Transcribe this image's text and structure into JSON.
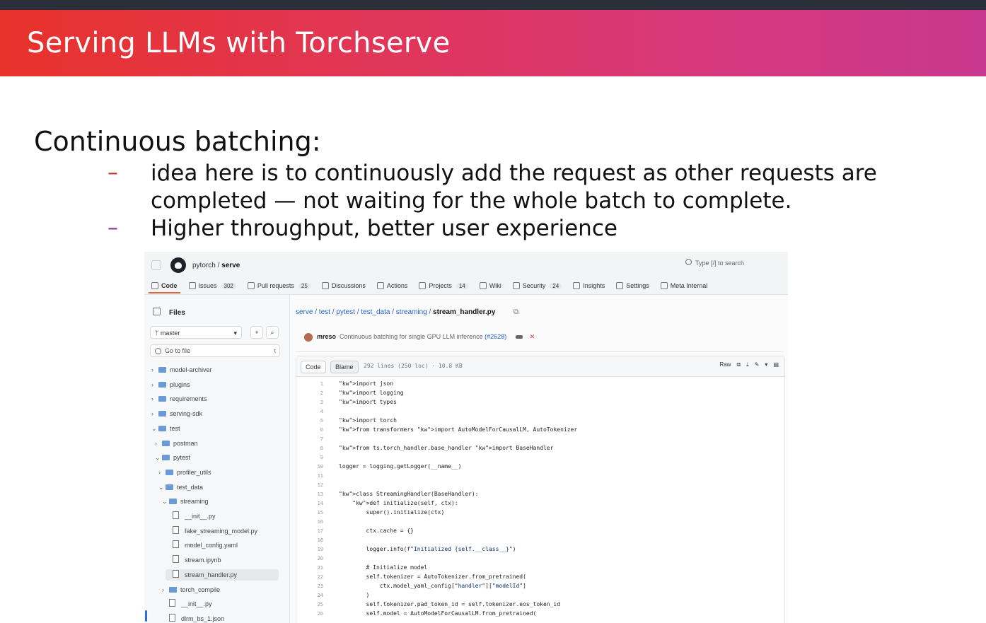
{
  "slide": {
    "title": "Serving LLMs with Torchserve",
    "heading": "Continuous batching:",
    "bullets": [
      "idea here is to continuously add the request as other requests are completed — not waiting for the whole batch to complete.",
      "Higher throughput, better user experience"
    ],
    "dash": "–"
  },
  "github": {
    "owner": "pytorch",
    "repo": "serve",
    "search_placeholder": "Type [/] to search",
    "tabs": [
      {
        "label": "Code",
        "count": ""
      },
      {
        "label": "Issues",
        "count": "302"
      },
      {
        "label": "Pull requests",
        "count": "25"
      },
      {
        "label": "Discussions",
        "count": ""
      },
      {
        "label": "Actions",
        "count": ""
      },
      {
        "label": "Projects",
        "count": "14"
      },
      {
        "label": "Wiki",
        "count": ""
      },
      {
        "label": "Security",
        "count": "24"
      },
      {
        "label": "Insights",
        "count": ""
      },
      {
        "label": "Settings",
        "count": ""
      },
      {
        "label": "Meta Internal",
        "count": ""
      }
    ],
    "sidebar": {
      "title": "Files",
      "branch": "master",
      "goto_placeholder": "Go to file",
      "goto_key": "t",
      "tree": [
        {
          "name": "model-archiver",
          "type": "folder",
          "depth": 0,
          "expanded": false
        },
        {
          "name": "plugins",
          "type": "folder",
          "depth": 0,
          "expanded": false
        },
        {
          "name": "requirements",
          "type": "folder",
          "depth": 0,
          "expanded": false
        },
        {
          "name": "serving-sdk",
          "type": "folder",
          "depth": 0,
          "expanded": false
        },
        {
          "name": "test",
          "type": "folder",
          "depth": 0,
          "expanded": true
        },
        {
          "name": "postman",
          "type": "folder",
          "depth": 1,
          "expanded": false
        },
        {
          "name": "pytest",
          "type": "folder",
          "depth": 1,
          "expanded": true
        },
        {
          "name": "profiler_utils",
          "type": "folder",
          "depth": 2,
          "expanded": false
        },
        {
          "name": "test_data",
          "type": "folder",
          "depth": 2,
          "expanded": true
        },
        {
          "name": "streaming",
          "type": "folder",
          "depth": 3,
          "expanded": true
        },
        {
          "name": "__init__.py",
          "type": "file",
          "depth": 4
        },
        {
          "name": "fake_streaming_model.py",
          "type": "file",
          "depth": 4
        },
        {
          "name": "model_config.yaml",
          "type": "file",
          "depth": 4
        },
        {
          "name": "stream.ipynb",
          "type": "file",
          "depth": 4
        },
        {
          "name": "stream_handler.py",
          "type": "file",
          "depth": 4,
          "selected": true
        },
        {
          "name": "torch_compile",
          "type": "folder",
          "depth": 3,
          "expanded": false
        },
        {
          "name": "__init__.py",
          "type": "file",
          "depth": 3
        },
        {
          "name": "dlrm_bs_1.json",
          "type": "file",
          "depth": 3
        }
      ]
    },
    "breadcrumb": [
      "serve",
      "test",
      "pytest",
      "test_data",
      "streaming"
    ],
    "breadcrumb_file": "stream_handler.py",
    "commit": {
      "author": "mreso",
      "message": "Continuous batching for single GPU LLM inference",
      "pr": "(#2628)"
    },
    "code_view": {
      "code_tab": "Code",
      "blame_tab": "Blame",
      "meta": "292 lines (250 loc) · 10.8 KB",
      "raw_label": "Raw",
      "lines": [
        {
          "n": "1",
          "t": "import json"
        },
        {
          "n": "2",
          "t": "import logging"
        },
        {
          "n": "3",
          "t": "import types"
        },
        {
          "n": "4",
          "t": ""
        },
        {
          "n": "5",
          "t": "import torch"
        },
        {
          "n": "6",
          "t": "from transformers import AutoModelForCausalLM, AutoTokenizer"
        },
        {
          "n": "7",
          "t": ""
        },
        {
          "n": "8",
          "t": "from ts.torch_handler.base_handler import BaseHandler"
        },
        {
          "n": "9",
          "t": ""
        },
        {
          "n": "10",
          "t": "logger = logging.getLogger(__name__)"
        },
        {
          "n": "11",
          "t": ""
        },
        {
          "n": "12",
          "t": ""
        },
        {
          "n": "13",
          "t": "class StreamingHandler(BaseHandler):"
        },
        {
          "n": "14",
          "t": "    def initialize(self, ctx):"
        },
        {
          "n": "15",
          "t": "        super().initialize(ctx)"
        },
        {
          "n": "16",
          "t": ""
        },
        {
          "n": "17",
          "t": "        ctx.cache = {}"
        },
        {
          "n": "18",
          "t": ""
        },
        {
          "n": "19",
          "t": "        logger.info(f\"Initialized {self.__class__}\")"
        },
        {
          "n": "20",
          "t": ""
        },
        {
          "n": "21",
          "t": "        # Initialize model"
        },
        {
          "n": "22",
          "t": "        self.tokenizer = AutoTokenizer.from_pretrained("
        },
        {
          "n": "23",
          "t": "            ctx.model_yaml_config[\"handler\"][\"modelId\"]"
        },
        {
          "n": "24",
          "t": "        )"
        },
        {
          "n": "25",
          "t": "        self.tokenizer.pad_token_id = self.tokenizer.eos_token_id"
        },
        {
          "n": "26",
          "t": "        self.model = AutoModelForCausalLM.from_pretrained("
        }
      ]
    }
  }
}
